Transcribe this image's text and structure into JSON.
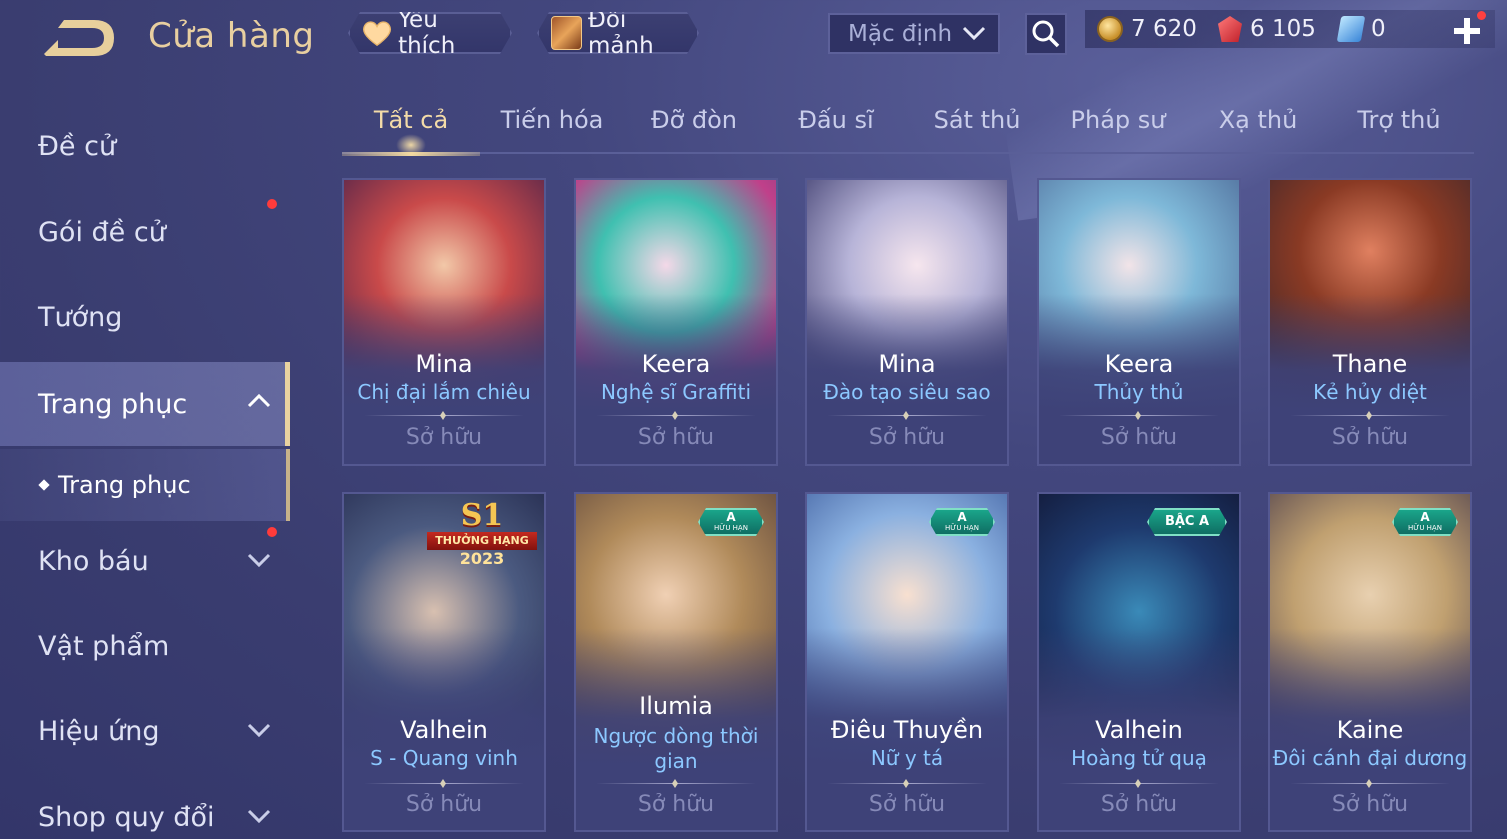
{
  "header": {
    "title": "Cửa hàng",
    "favorites_label": "Yêu thích",
    "exchange_label": "Đổi mảnh",
    "sort_value": "Mặc định"
  },
  "currency": {
    "gold": "7 620",
    "ruby": "6 105",
    "voucher": "0"
  },
  "sidebar": {
    "items": [
      {
        "label": "Đề cử"
      },
      {
        "label": "Gói đề cử"
      },
      {
        "label": "Tướng"
      },
      {
        "label": "Trang phục"
      },
      {
        "label": "Trang phục"
      },
      {
        "label": "Kho báu"
      },
      {
        "label": "Vật phẩm"
      },
      {
        "label": "Hiệu ứng"
      },
      {
        "label": "Shop quy đổi"
      }
    ]
  },
  "tabs": [
    {
      "label": "Tất cả"
    },
    {
      "label": "Tiến hóa"
    },
    {
      "label": "Đỡ đòn"
    },
    {
      "label": "Đấu sĩ"
    },
    {
      "label": "Sát thủ"
    },
    {
      "label": "Pháp sư"
    },
    {
      "label": "Xạ thủ"
    },
    {
      "label": "Trợ thủ"
    }
  ],
  "cards": [
    {
      "hero": "Mina",
      "skin": "Chị đại lắm chiêu",
      "status": "Sở hữu",
      "accent": "#c94a4a"
    },
    {
      "hero": "Keera",
      "skin": "Nghệ sĩ Graffiti",
      "status": "Sở hữu",
      "accent": "#3fc0b0"
    },
    {
      "hero": "Mina",
      "skin": "Đào tạo siêu sao",
      "status": "Sở hữu",
      "accent": "#b7b4d8"
    },
    {
      "hero": "Keera",
      "skin": "Thủy thủ",
      "status": "Sở hữu",
      "accent": "#7eb8d8"
    },
    {
      "hero": "Thane",
      "skin": "Kẻ hủy diệt",
      "status": "Sở hữu",
      "accent": "#8a3a24"
    },
    {
      "hero": "Valhein",
      "skin": "S - Quang vinh",
      "status": "Sở hữu",
      "accent": "#4b5a80",
      "badge": {
        "line1": "S1",
        "line2": "THƯỞNG HẠNG",
        "line3": "2023"
      }
    },
    {
      "hero": "Ilumia",
      "skin_line1": "Ngược dòng thời",
      "skin_line2": "gian",
      "status": "Sở hữu",
      "accent": "#b08a5a",
      "badge": {
        "line1": "A",
        "line2": "HỮU HẠN"
      }
    },
    {
      "hero": "Điêu Thuyền",
      "skin": "Nữ y tá",
      "status": "Sở hữu",
      "accent": "#8ab0e0",
      "badge": {
        "line1": "A",
        "line2": "HỮU HẠN"
      }
    },
    {
      "hero": "Valhein",
      "skin": "Hoàng tử quạ",
      "status": "Sở hữu",
      "accent": "#1e3a6e",
      "badge": {
        "line1": "BẬC A"
      }
    },
    {
      "hero": "Kaine",
      "skin": "Đôi cánh đại dương",
      "status": "Sở hữu",
      "accent": "#c0a070",
      "badge": {
        "line1": "A",
        "line2": "HỮU HẠN"
      }
    }
  ],
  "colors": {
    "gold_accent": "#e8cfa0",
    "skin_name": "#8cc8ff",
    "owned": "#868ab8",
    "notification": "#ff3b3b"
  }
}
